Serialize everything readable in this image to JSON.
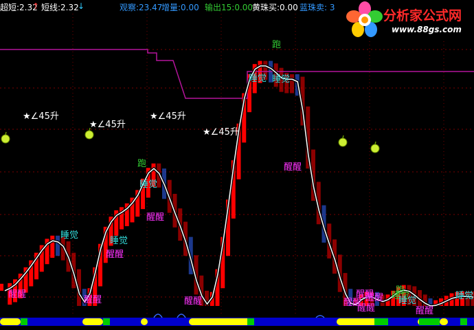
{
  "header": {
    "item1": "超短:2.32",
    "item2": "短线:2.32",
    "item3": "观察:23.47",
    "item4": "增量:0.00",
    "item5": "输出15:0.00",
    "item6": "黄珠买:0.00",
    "item7": "蓝珠卖: 3"
  },
  "logo": {
    "name": "分析家公式网",
    "url": "www.88gs.com"
  },
  "colors": {
    "background": "#000000",
    "grid": "#7a0000",
    "red_bar": "#ff0000",
    "blue_bar": "#3366ff",
    "yellow_bar": "#ffcc00",
    "purple_line": "#b4149b",
    "white_line": "#ffffff",
    "green_text": "#33cc33",
    "magenta_text": "#ff33ff",
    "cyan_text": "#33dddd",
    "bottom_band_blue": "#0000cc",
    "bottom_band_yellow": "#ffff00",
    "bottom_band_green": "#00cc00"
  },
  "chart_data": {
    "type": "line",
    "grid": true,
    "yticks": [],
    "series": [
      {
        "values": [
          2.4,
          2.8,
          3.4,
          4.3,
          5.3,
          6.4,
          7.6,
          8.8,
          9.8,
          10.3,
          10.1,
          9.4,
          7.6,
          5.0,
          1.9,
          0.6,
          2.0,
          5.3,
          9.0,
          11.7,
          13.3,
          14.3,
          14.8,
          15.4,
          16.3,
          17.5,
          19.3,
          21.0,
          21.7,
          20.9,
          19.1,
          16.9,
          14.6,
          12.5,
          10.1,
          7.2,
          4.0,
          1.6,
          0.3,
          1.4,
          5.0,
          10.1,
          16.0,
          22.2,
          28.0,
          32.8,
          35.8,
          37.4,
          37.9,
          37.9,
          37.5,
          36.8,
          36.0,
          35.8,
          35.8,
          35.4,
          30.7,
          23.9,
          18.8,
          15.1,
          12.2,
          9.7,
          7.3,
          4.4,
          1.9,
          0.4,
          0.2,
          1.0,
          1.4,
          1.4,
          1.0,
          0.7,
          1.0,
          1.6,
          2.2,
          2.5,
          2.3,
          1.7,
          1.0,
          0.4,
          0.0,
          0.1,
          0.4,
          0.8,
          1.2,
          1.4,
          1.5,
          1.5,
          1.4
        ]
      },
      {
        "values": [
          36.5,
          36.5,
          36.5,
          36.5,
          36.5,
          36.5,
          36.5,
          36.5,
          36.5,
          36.5,
          36.5,
          36.5,
          36.5,
          36.5,
          36.5,
          36.5,
          36.5,
          36.5,
          36.5,
          36.5,
          36.5,
          36.5,
          36.5,
          36.5,
          36.5,
          36.5,
          36.5,
          36.5,
          36.5,
          36.5,
          36.5,
          36.5,
          36.5,
          36.5,
          36.5,
          36.5,
          36.5,
          36.5,
          36.5,
          36.5,
          36.5,
          36.5,
          36.5,
          36.5,
          36.5,
          36.5,
          36.5,
          36.5,
          36.5,
          36.5,
          36.5,
          36.5,
          36.5,
          36.5,
          36.5,
          36.5,
          36.5,
          36.5,
          36.5,
          36.5,
          36.5,
          36.5,
          36.5,
          36.5,
          36.5,
          36.5,
          36.5,
          36.5,
          36.5,
          36.5,
          36.5,
          36.5,
          36.5,
          36.5,
          36.5,
          36.5,
          36.5,
          36.5,
          36.5,
          36.5,
          36.5,
          36.5,
          36.5,
          36.5,
          36.5,
          36.5,
          36.5,
          36.5,
          36.5
        ]
      }
    ],
    "bars": [
      {
        "color": "red",
        "from": 2.4,
        "to": 3.0
      },
      {
        "color": "red",
        "from": 3.0,
        "to": 3.5
      }
    ],
    "annotations": [
      {
        "text": "醒醒",
        "color": "magenta"
      },
      {
        "text": "睡觉",
        "color": "cyan"
      },
      {
        "text": "醒醒",
        "color": "magenta"
      },
      {
        "text": "睡觉",
        "color": "cyan"
      },
      {
        "text": "醒醒",
        "color": "magenta"
      },
      {
        "text": "醒醒",
        "color": "magenta"
      },
      {
        "text": "跑",
        "color": "green"
      },
      {
        "text": "睡觉",
        "color": "cyan"
      },
      {
        "text": "醒醒",
        "color": "magenta"
      },
      {
        "text": "醒醒",
        "color": "magenta"
      },
      {
        "text": "★∠45升",
        "color": "white"
      },
      {
        "text": "★∠45升",
        "color": "white"
      },
      {
        "text": "★∠45升",
        "color": "white"
      },
      {
        "text": "★∠45升",
        "color": "white"
      },
      {
        "text": "跑",
        "color": "green"
      },
      {
        "text": "睡觉",
        "color": "cyan"
      },
      {
        "text": "睡觉",
        "color": "cyan"
      },
      {
        "text": "醒醒",
        "color": "magenta"
      },
      {
        "text": "醒醒",
        "color": "magenta"
      },
      {
        "text": "醒醒",
        "color": "magenta"
      },
      {
        "text": "醒醒",
        "color": "magenta"
      },
      {
        "text": "睡觉",
        "color": "green"
      },
      {
        "text": "跑",
        "color": "green"
      },
      {
        "text": "睡觉",
        "color": "cyan"
      },
      {
        "text": "醒醒",
        "color": "magenta"
      },
      {
        "text": "睡觉",
        "color": "cyan"
      }
    ]
  }
}
